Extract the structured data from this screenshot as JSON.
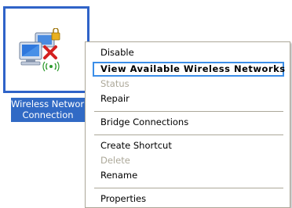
{
  "desktop": {
    "icon_name": "network-connection-icon",
    "label_line1": "Wireless Network",
    "label_line2": "Connection"
  },
  "context_menu": {
    "items": [
      {
        "label": "Disable",
        "state": "enabled"
      },
      {
        "label": "View Available Wireless Networks",
        "state": "default-highlighted"
      },
      {
        "label": "Status",
        "state": "disabled"
      },
      {
        "label": "Repair",
        "state": "enabled"
      },
      {
        "label": "Bridge Connections",
        "state": "enabled"
      },
      {
        "label": "Create Shortcut",
        "state": "enabled"
      },
      {
        "label": "Delete",
        "state": "disabled"
      },
      {
        "label": "Rename",
        "state": "enabled"
      },
      {
        "label": "Properties",
        "state": "enabled"
      }
    ]
  },
  "colors": {
    "selection_blue": "#316ac5",
    "icon_border": "#2f63c8",
    "menu_highlight_border": "#3b8ee8",
    "disabled_text": "#aca899"
  }
}
